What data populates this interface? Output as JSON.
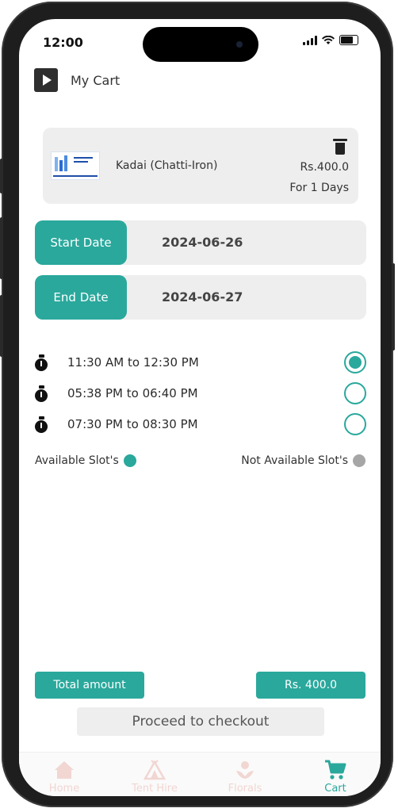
{
  "status_bar": {
    "time": "12:00"
  },
  "header": {
    "title": "My Cart"
  },
  "cart_item": {
    "name": "Kadai (Chatti-Iron)",
    "price": "Rs.400.0",
    "duration": "For 1 Days"
  },
  "dates": {
    "start_label": "Start Date",
    "start_value": "2024-06-26",
    "end_label": "End Date",
    "end_value": "2024-06-27"
  },
  "slots": [
    {
      "time": "11:30 AM to 12:30 PM",
      "selected": true
    },
    {
      "time": "05:38 PM to 06:40 PM",
      "selected": false
    },
    {
      "time": "07:30 PM to 08:30 PM",
      "selected": false
    }
  ],
  "legend": {
    "available": "Available Slot's",
    "not_available": "Not Available Slot's",
    "available_color": "#2aa89c",
    "not_available_color": "#a6a6a6"
  },
  "summary": {
    "total_label": "Total amount",
    "total_value": "Rs. 400.0",
    "checkout_label": "Proceed to checkout"
  },
  "nav": [
    {
      "label": "Home",
      "icon": "home-icon",
      "active": false
    },
    {
      "label": "Tent Hire",
      "icon": "tent-icon",
      "active": false
    },
    {
      "label": "Florals",
      "icon": "flower-icon",
      "active": false
    },
    {
      "label": "Cart",
      "icon": "cart-icon",
      "active": true
    }
  ],
  "colors": {
    "accent": "#2aa89c",
    "inactive_nav": "#f1d6d2"
  }
}
